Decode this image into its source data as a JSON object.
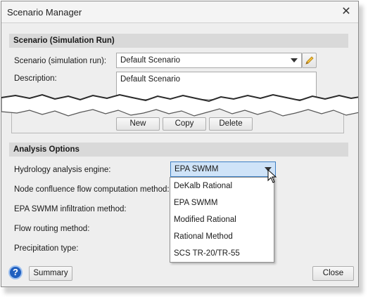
{
  "window": {
    "title": "Scenario Manager"
  },
  "scenario_section": {
    "header": "Scenario (Simulation Run)",
    "scenario_label": "Scenario (simulation run):",
    "scenario_value": "Default Scenario",
    "description_label": "Description:",
    "description_value": "Default Scenario",
    "new_label": "New",
    "copy_label": "Copy",
    "delete_label": "Delete"
  },
  "analysis_section": {
    "header": "Analysis Options",
    "engine_label": "Hydrology analysis engine:",
    "engine_value": "EPA SWMM",
    "node_label": "Node confluence flow computation method:",
    "infiltration_label": "EPA SWMM infiltration method:",
    "routing_label": "Flow routing method:",
    "precip_label": "Precipitation type:",
    "engine_options": [
      "DeKalb Rational",
      "EPA SWMM",
      "Modified Rational",
      "Rational Method",
      "SCS TR-20/TR-55"
    ]
  },
  "footer": {
    "help_label": "?",
    "summary_label": "Summary",
    "close_label": "Close"
  },
  "colors": {
    "selected_field": "#cfe3f8",
    "selected_border": "#3d7fc4",
    "help_icon": "#1f5fbf"
  }
}
